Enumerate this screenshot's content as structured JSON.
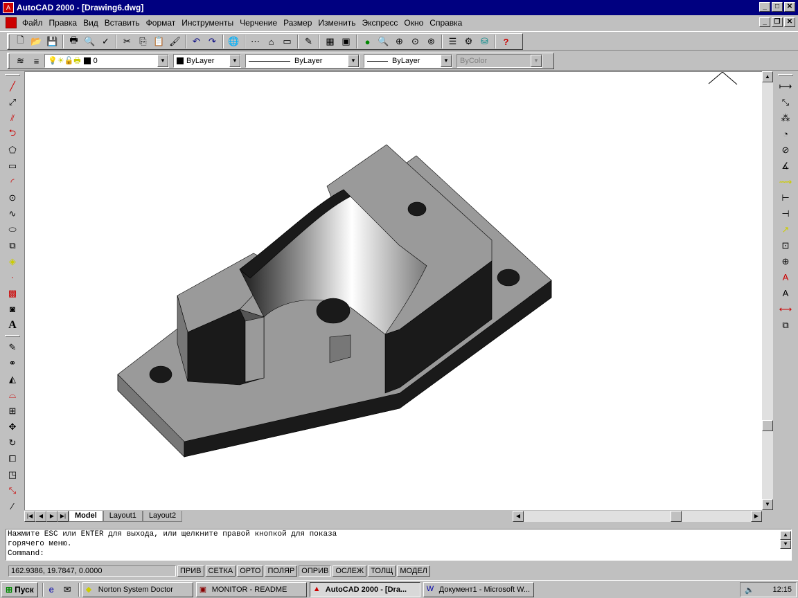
{
  "window": {
    "title": "AutoCAD 2000 - [Drawing6.dwg]",
    "app_icon": "autocad-icon"
  },
  "menu": [
    "Файл",
    "Правка",
    "Вид",
    "Вставить",
    "Формат",
    "Инструменты",
    "Черчение",
    "Размер",
    "Изменить",
    "Экспресс",
    "Окно",
    "Справка"
  ],
  "properties": {
    "layer": "0",
    "color": "ByLayer",
    "linetype": "ByLayer",
    "lineweight": "ByLayer",
    "plotstyle": "ByColor"
  },
  "tabs": {
    "model": "Model",
    "layout1": "Layout1",
    "layout2": "Layout2"
  },
  "command": {
    "line1": "Нажмите ESC или ENTER для выхода, или щелкните правой кнопкой для показа",
    "line2": "горячего меню.",
    "prompt": "Command:"
  },
  "status": {
    "coords": "162.9386, 19.7847, 0.0000",
    "buttons": [
      "ПРИВ",
      "СЕТКА",
      "ОРТО",
      "ПОЛЯР",
      "ОПРИВ",
      "ОСЛЕЖ",
      "ТОЛЩ",
      "МОДЕЛ"
    ]
  },
  "taskbar": {
    "start": "Пуск",
    "tasks": [
      "Norton System Doctor",
      "MONITOR - README",
      "AutoCAD 2000 - [Dra...",
      "Документ1 - Microsoft W..."
    ],
    "clock": "12:15"
  },
  "colors": {
    "titlebar": "#000080",
    "canvas": "#ffffff",
    "model_top": "#9a9a9a",
    "model_dark": "#1a1a1a"
  }
}
